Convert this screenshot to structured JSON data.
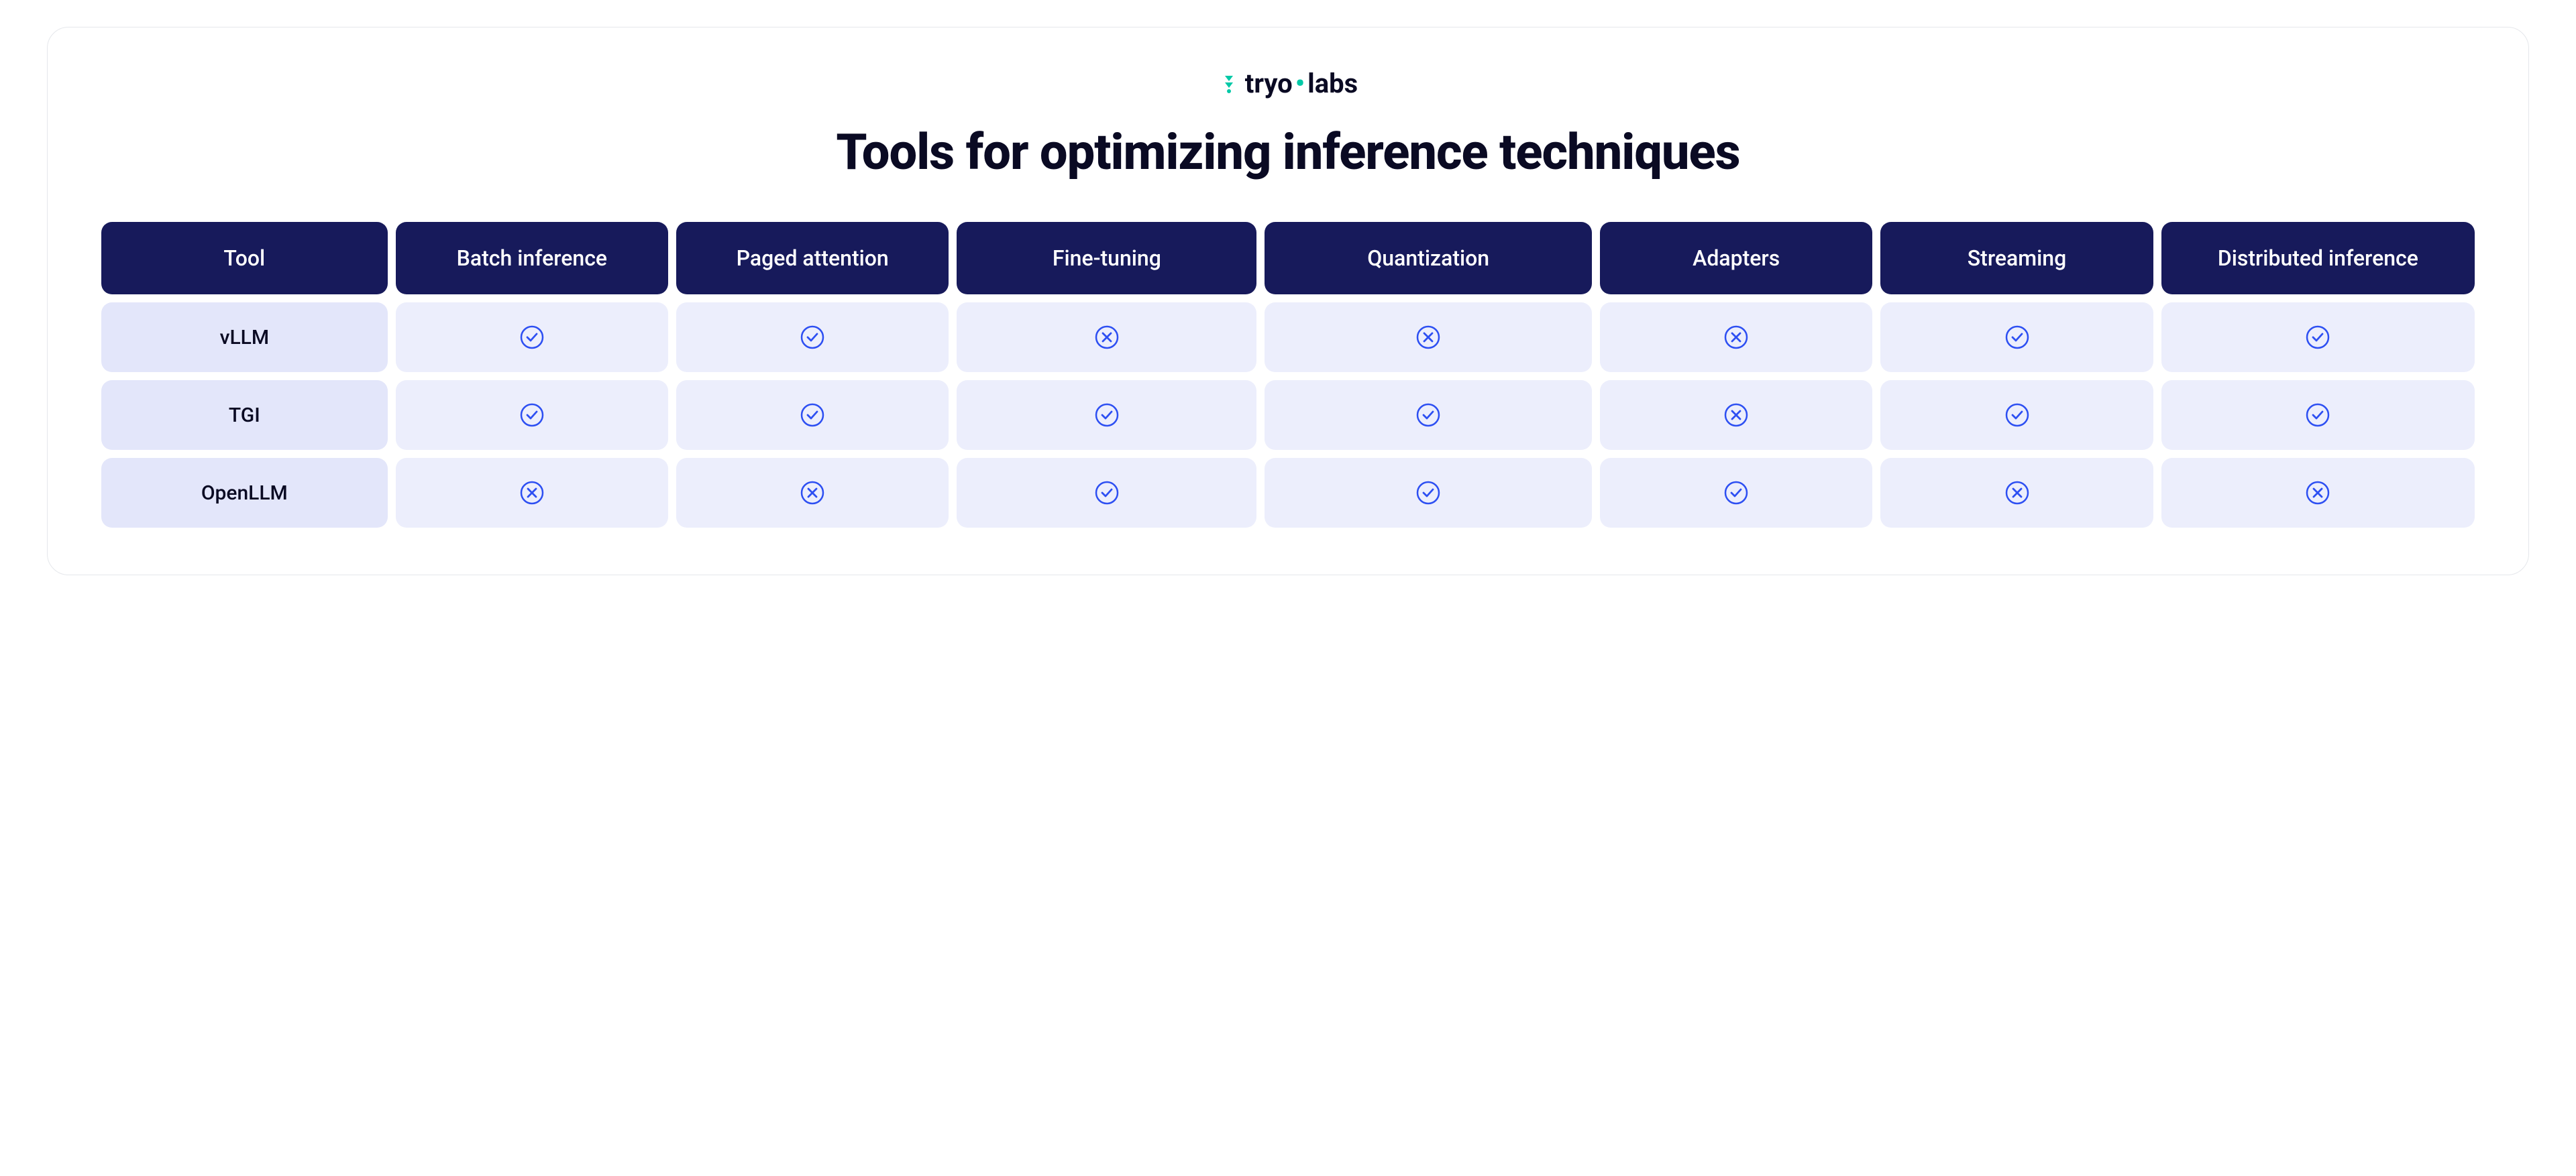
{
  "brand": {
    "first": "tryo",
    "second": "labs"
  },
  "title": "Tools for optimizing inference techniques",
  "chart_data": {
    "type": "table",
    "title": "Tools for optimizing inference techniques",
    "columns": [
      "Tool",
      "Batch inference",
      "Paged attention",
      "Fine-tuning",
      "Quantization",
      "Adapters",
      "Streaming",
      "Distributed inference"
    ],
    "rows": [
      {
        "name": "vLLM",
        "values": [
          true,
          true,
          false,
          false,
          false,
          true,
          true
        ]
      },
      {
        "name": "TGI",
        "values": [
          true,
          true,
          true,
          true,
          false,
          true,
          true
        ]
      },
      {
        "name": "OpenLLM",
        "values": [
          false,
          false,
          true,
          true,
          true,
          false,
          false
        ]
      }
    ]
  }
}
